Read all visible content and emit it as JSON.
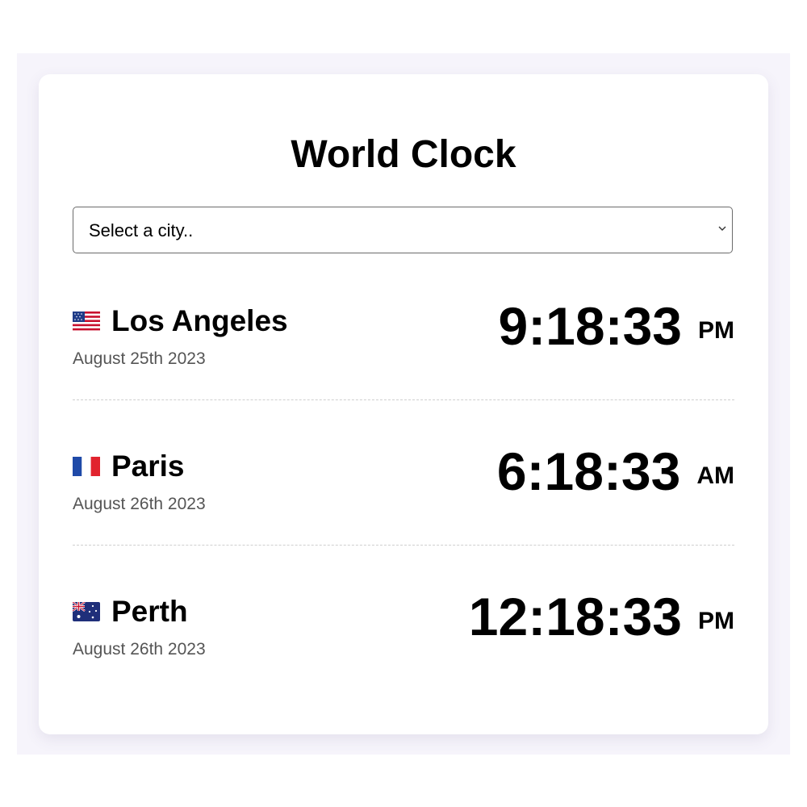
{
  "header": {
    "title": "World Clock"
  },
  "city_select": {
    "selected": "Select a city.."
  },
  "cities": [
    {
      "flag": "us-flag-icon",
      "name": "Los Angeles",
      "date": "August 25th 2023",
      "time": "9:18:33",
      "period": "PM"
    },
    {
      "flag": "france-flag-icon",
      "name": "Paris",
      "date": "August 26th 2023",
      "time": "6:18:33",
      "period": "AM"
    },
    {
      "flag": "australia-flag-icon",
      "name": "Perth",
      "date": "August 26th 2023",
      "time": "12:18:33",
      "period": "PM"
    }
  ],
  "colors": {
    "backdrop": "#f6f4fb",
    "card": "#ffffff",
    "date_text": "#555555",
    "divider": "#cfcfcf"
  }
}
